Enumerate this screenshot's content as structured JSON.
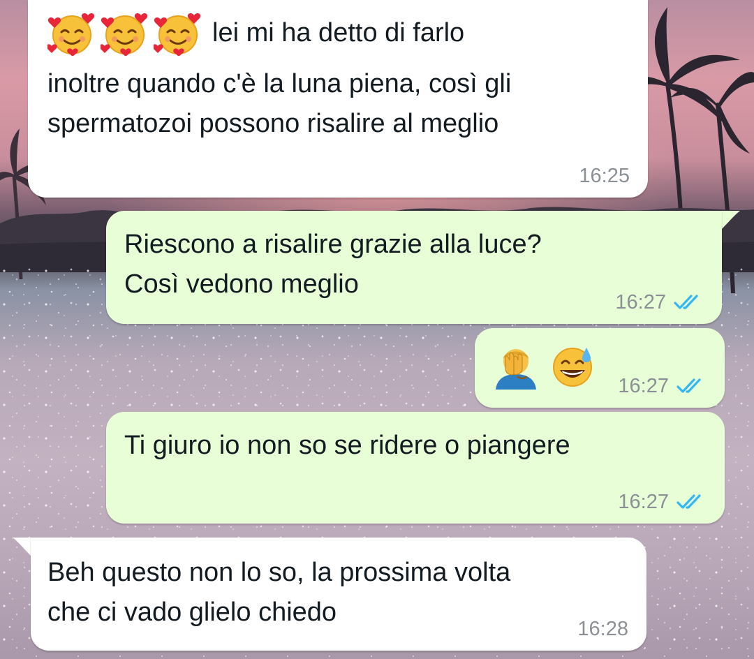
{
  "conversation": {
    "messages": [
      {
        "direction": "incoming",
        "emoji_prefix": [
          "smiling-face-with-hearts-icon",
          "smiling-face-with-hearts-icon",
          "smiling-face-with-hearts-icon"
        ],
        "text_first_line": "lei mi ha detto di farlo",
        "text_rest": "inoltre quando c'è la luna piena, così gli\nspermatozoi possono risalire al meglio",
        "time": "16:25"
      },
      {
        "direction": "outgoing",
        "text": "Riescono a risalire grazie alla luce?\nCosì vedono meglio",
        "time": "16:27",
        "status": "read"
      },
      {
        "direction": "outgoing",
        "emoji_only": [
          "man-facepalming-icon",
          "grinning-face-with-sweat-icon"
        ],
        "time": "16:27",
        "status": "read"
      },
      {
        "direction": "outgoing",
        "text": "Ti giuro io non so se ridere o piangere",
        "time": "16:27",
        "status": "read"
      },
      {
        "direction": "incoming",
        "text": "Beh questo non lo so, la prossima volta\nche ci vado glielo chiedo",
        "time": "16:28"
      }
    ]
  },
  "colors": {
    "incoming_bubble": "#ffffff",
    "outgoing_bubble": "#e7fed7",
    "read_ticks": "#34b7f1",
    "timestamp": "#8a9096"
  }
}
